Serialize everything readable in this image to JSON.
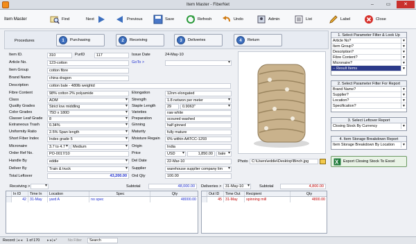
{
  "window": {
    "title": "Item Master - FiberNet",
    "min": "–",
    "max": "▭",
    "close": "✕"
  },
  "toolbar": {
    "form_title": "Item Master",
    "find": "Find",
    "next": "Next",
    "previous": "Previous",
    "save": "Save",
    "refresh": "Refresh",
    "undo": "Undo",
    "admin": "Admin",
    "list": "List",
    "label": "Label",
    "close": "Close"
  },
  "procedures": {
    "label": "Procedures",
    "buttons": [
      {
        "num": "1",
        "label": "Purchasing"
      },
      {
        "num": "2",
        "label": "Receiving"
      },
      {
        "num": "3",
        "label": "Deliveries"
      },
      {
        "num": "4",
        "label": "Return"
      }
    ]
  },
  "item": {
    "item_id_label": "Item ID.",
    "item_id": "310",
    "purid_label": "PurID",
    "purid": "117",
    "issue_date_label": "Issue Date",
    "issue_date": "24-May-10",
    "goto_label": "GoTo >",
    "goto": "",
    "article_label": "Article No.",
    "article": "123-cotton",
    "group_label": "Item Group",
    "group": "cotton fibre",
    "brand_label": "Brand Name",
    "brand": "china dragon",
    "desc_label": "Description",
    "desc": "cotton bale - 480lb weightd",
    "content_label": "Fibre Content",
    "content": "98% cotton 2% polyamide",
    "class_label": "Class",
    "class": "AOM",
    "quality_label": "Quality Grades",
    "quality": "Strict low middling",
    "color_label": "Color Grades",
    "color": "75D x 180D",
    "classer_label": "Classer Leaf Grade",
    "classer": "8",
    "trash_label": "Extraneous Trash",
    "trash": "0.34%",
    "uniformity_label": "Uniformity Ratio",
    "uniformity": "2.5% Span length",
    "short_label": "Short Fiber Index",
    "short": "Index grade 5",
    "micronaire_label": "Micronaire",
    "micronaire": "3.7 to 4.7",
    "micronaire_grade": "Medium",
    "order_label": "Order Ref No.",
    "order": "PO-0017/10",
    "handle_label": "Handle By",
    "handle": "eddie",
    "deliver_label": "Deliver By",
    "deliver": "Train & truck",
    "leftover_label": "Total Leftover",
    "leftover": "43,200.00",
    "elongation_label": "Elongation",
    "elongation": "12nm elongated",
    "strength_label": "Strength",
    "strength": "1.8 netwon per meter",
    "staple_label": "Staple Length",
    "staple_a": "29",
    "staple_b": "0.9063\"",
    "varieties_label": "Varieties",
    "varieties": "raw white",
    "prep_label": "Preparation",
    "prep": "scoured washed",
    "ginning_label": "Ginning",
    "ginning": "half ginned",
    "maturity_label": "Maturity",
    "maturity": "fully mature",
    "moisture_label": "Moisture Regain",
    "moisture": "6% within AATCC-1293",
    "origin_label": "Origin",
    "origin": "India",
    "price_label": "Price",
    "currency": "USD",
    "price": "1,850.00",
    "unit": "bale",
    "deldate_label": "Del Date",
    "deldate": "22-Mar-10",
    "supplier_label": "Supplier",
    "supplier": "warehouse supplier company lim",
    "ordqty_label": "Ord Qty",
    "ordqty": "100.00",
    "photo_label": "Photo",
    "photo_path": "C:\\Users\\eddie\\Desktop\\Binch.jpg"
  },
  "filter_lookup": {
    "title": "1. Select Parameter Filter & Look Up",
    "items": [
      "Article No?",
      "Item Group?",
      "Description?",
      "Fibre Content?",
      "Micronaire?",
      "-- Result Items"
    ]
  },
  "filter_report": {
    "title": "2. Select Parameter Filter For Report",
    "items": [
      "Brand Name?",
      "Supplier?",
      "Location?",
      "Specification?"
    ]
  },
  "leftover_report": {
    "title": "3. Select Leftover Report",
    "value": "Closing Stock By Currency"
  },
  "storage_report": {
    "title": "4. Item Storage Breakdown Report",
    "value": "Item Storage Breakdown By Location"
  },
  "export": {
    "label": "Export Closing Stock To Excel"
  },
  "receiving": {
    "label": "Receiving >",
    "subtotal_label": "Subtotal",
    "subtotal": "48,000.00",
    "columns": [
      "In ID",
      "Time In",
      "Location",
      "Spec",
      "Qty"
    ],
    "rows": [
      [
        "42",
        "31-May",
        "yard A",
        "no spec",
        "48000.00"
      ]
    ]
  },
  "deliveries": {
    "label": "Deliveries >",
    "date": "31-May-10",
    "subtotal_label": "Subtotal",
    "subtotal": "4,800.00",
    "columns": [
      "Out ID",
      "Time Out",
      "Recipient",
      "Qty"
    ],
    "rows": [
      [
        "45",
        "31-May",
        "spinning mill",
        "4800.00"
      ]
    ]
  },
  "statusbar": {
    "record_label": "Record:",
    "position": "1 of 170",
    "filter": "No Filter",
    "search": "Search"
  },
  "colors": {
    "accent": "#3c6fbf",
    "close": "#c9302c",
    "red_text": "#c00000",
    "blue_text": "#1a2bd0"
  }
}
